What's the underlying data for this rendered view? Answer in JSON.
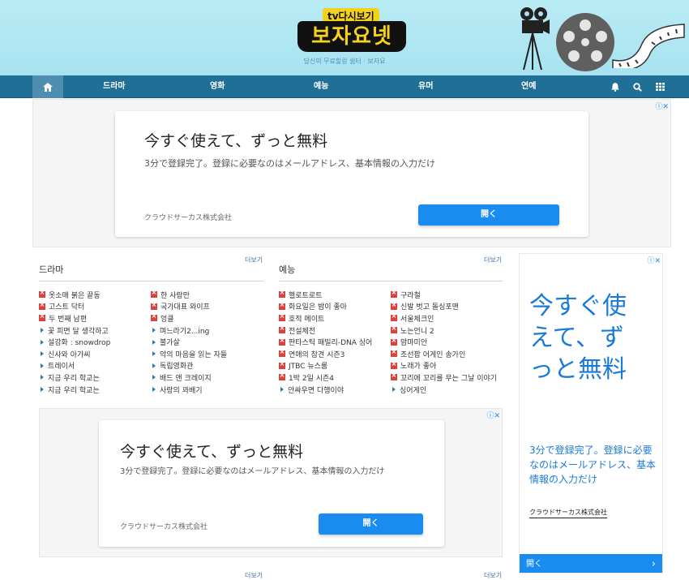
{
  "header": {
    "logo_small": "tv다시보기",
    "logo_main": "보자요넷",
    "tagline": "당신의 무료힐링 쉼터 · 보자요"
  },
  "nav": {
    "items": [
      "드라마",
      "영화",
      "예능",
      "유머",
      "연예"
    ]
  },
  "ads": {
    "title": "今すぐ使えて、ずっと無料",
    "desc": "3分で登録完了。登録に必要なのはメールアドレス、基本情報の入力だけ",
    "company": "クラウドサーカス株式会社",
    "button": "開く",
    "side_title": "今すぐ使えて、ずっと無料",
    "side_desc": "3分で登録完了。登録に必要なのはメールアドレス、基本情報の入力だけ"
  },
  "drama": {
    "title": "드라마",
    "more": "더보기",
    "col1": [
      {
        "text": "옷소매 붉은 끝동",
        "new": true
      },
      {
        "text": "고스트 닥터",
        "new": true
      },
      {
        "text": "두 번째 남편",
        "new": true
      },
      {
        "text": "꽃 피면 달 생각하고",
        "new": false
      },
      {
        "text": "설강화 : snowdrop",
        "new": false
      },
      {
        "text": "신사와 아가씨",
        "new": false
      },
      {
        "text": "트레이서",
        "new": false
      },
      {
        "text": "지금 우리 학교는",
        "new": false
      },
      {
        "text": "지금 우리 학교는",
        "new": false
      }
    ],
    "col2": [
      {
        "text": "한 사람만",
        "new": true
      },
      {
        "text": "국가대표 와이프",
        "new": true
      },
      {
        "text": "엉클",
        "new": true
      },
      {
        "text": "며느라기2...ing",
        "new": false
      },
      {
        "text": "불가살",
        "new": false
      },
      {
        "text": "악의 마음을 읽는 자들",
        "new": false
      },
      {
        "text": "독립영화관",
        "new": false
      },
      {
        "text": "배드 앤 크레이지",
        "new": false
      },
      {
        "text": "사랑의 꽈배기",
        "new": false
      }
    ]
  },
  "variety": {
    "title": "예능",
    "more": "더보기",
    "col1": [
      {
        "text": "헬로트로트",
        "new": true
      },
      {
        "text": "화요일은 밤이 좋아",
        "new": true
      },
      {
        "text": "호적 메이트",
        "new": true
      },
      {
        "text": "전설체전",
        "new": true
      },
      {
        "text": "판타스틱 패밀리-DNA 싱어",
        "new": true
      },
      {
        "text": "연애의 참견 시즌3",
        "new": true
      },
      {
        "text": "JTBC 뉴스룸",
        "new": true
      },
      {
        "text": "1박 2일 시즌4",
        "new": true
      },
      {
        "text": "안싸우면 다행이야",
        "new": false
      }
    ],
    "col2": [
      {
        "text": "구라철",
        "new": true
      },
      {
        "text": "신발 벗고 돌싱포맨",
        "new": true
      },
      {
        "text": "서울체크인",
        "new": true
      },
      {
        "text": "노는언니 2",
        "new": true
      },
      {
        "text": "맘마미안",
        "new": true
      },
      {
        "text": "조선팝 어게인 송가인",
        "new": true
      },
      {
        "text": "노래가 좋아",
        "new": true
      },
      {
        "text": "꼬리에 꼬리를 무는 그날 이야기",
        "new": true
      },
      {
        "text": "싱어게인",
        "new": false
      }
    ]
  },
  "footer": {
    "more_left": "더보기",
    "more_right": "더보기"
  },
  "colors": {
    "nav": "#1f6f96",
    "accent": "#1a8bf0",
    "badge": "#d8433c"
  }
}
